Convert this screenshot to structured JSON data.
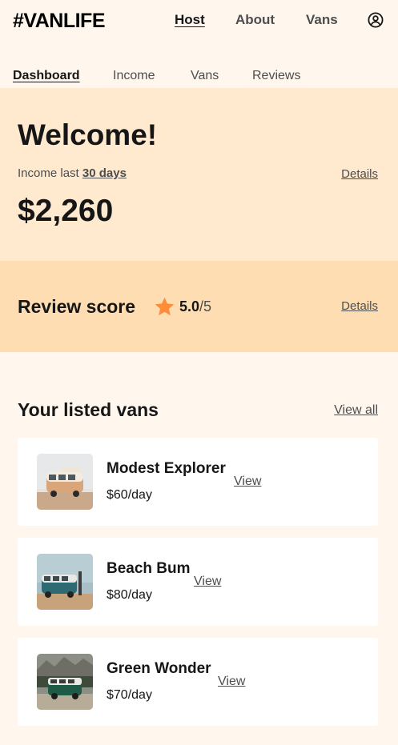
{
  "header": {
    "logo": "#VANLIFE",
    "nav": [
      {
        "label": "Host",
        "active": true
      },
      {
        "label": "About",
        "active": false
      },
      {
        "label": "Vans",
        "active": false
      }
    ],
    "user_icon": "user-circle-icon"
  },
  "subnav": [
    {
      "label": "Dashboard",
      "active": true
    },
    {
      "label": "Income",
      "active": false
    },
    {
      "label": "Vans",
      "active": false
    },
    {
      "label": "Reviews",
      "active": false
    }
  ],
  "welcome": {
    "title": "Welcome!",
    "income_prefix": "Income last ",
    "income_period": "30 days",
    "amount": "$2,260",
    "details_label": "Details"
  },
  "review": {
    "title": "Review score",
    "star_icon": "star-icon",
    "score": "5.0",
    "max": "/5",
    "details_label": "Details"
  },
  "vans": {
    "title": "Your listed vans",
    "view_all_label": "View all",
    "items": [
      {
        "name": "Modest Explorer",
        "price": "$60/day",
        "view_label": "View"
      },
      {
        "name": "Beach Bum",
        "price": "$80/day",
        "view_label": "View"
      },
      {
        "name": "Green Wonder",
        "price": "$70/day",
        "view_label": "View"
      }
    ]
  },
  "colors": {
    "page_bg": "#FFF7ED",
    "welcome_bg": "#FFEAD0",
    "review_bg": "#FFDDB2",
    "star": "#FF8C38",
    "text_dark": "#161616",
    "text_muted": "#4D4D4D"
  }
}
